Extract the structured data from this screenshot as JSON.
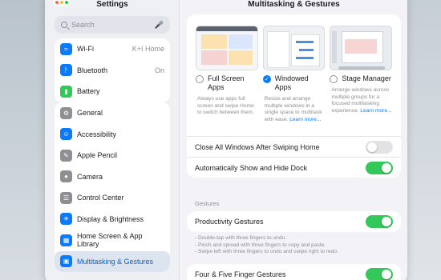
{
  "sidebar": {
    "title": "Settings",
    "search_placeholder": "Search",
    "items": [
      {
        "label": "Wi-Fi",
        "value": "K+I Home",
        "icon": "wifi-icon",
        "color": "#0a7aff"
      },
      {
        "label": "Bluetooth",
        "value": "On",
        "icon": "bluetooth-icon",
        "color": "#0a7aff"
      },
      {
        "label": "Battery",
        "value": "",
        "icon": "battery-icon",
        "color": "#34c759"
      },
      {
        "label": "General",
        "icon": "gear-icon",
        "color": "#8e8e93"
      },
      {
        "label": "Accessibility",
        "icon": "accessibility-icon",
        "color": "#0a7aff"
      },
      {
        "label": "Apple Pencil",
        "icon": "pencil-icon",
        "color": "#8e8e93"
      },
      {
        "label": "Camera",
        "icon": "camera-icon",
        "color": "#8e8e93"
      },
      {
        "label": "Control Center",
        "icon": "control-center-icon",
        "color": "#8e8e93"
      },
      {
        "label": "Display & Brightness",
        "icon": "sun-icon",
        "color": "#0a7aff"
      },
      {
        "label": "Home Screen & App Library",
        "icon": "home-screen-icon",
        "color": "#0a7aff"
      },
      {
        "label": "Multitasking & Gestures",
        "icon": "multitasking-icon",
        "color": "#0a7aff"
      }
    ]
  },
  "main": {
    "title": "Multitasking & Gestures",
    "options": [
      {
        "label": "Full Screen Apps",
        "desc": "Always use apps full screen and swipe Home to switch between them.",
        "link": ""
      },
      {
        "label": "Windowed Apps",
        "desc": "Resize and arrange multiple windows in a single space to multitask with ease.",
        "link": "Learn more..."
      },
      {
        "label": "Stage Manager",
        "desc": "Arrange windows across multiple groups for a focused multitasking experience.",
        "link": "Learn more..."
      }
    ],
    "toggles": [
      {
        "label": "Close All Windows After Swiping Home",
        "on": false
      },
      {
        "label": "Automatically Show and Hide Dock",
        "on": true
      }
    ],
    "gestures_header": "Gestures",
    "productivity": {
      "label": "Productivity Gestures",
      "on": true
    },
    "productivity_notes": [
      "- Double-tap with three fingers to undo.",
      "- Pinch and spread with three fingers to copy and paste.",
      "- Swipe left with three fingers to undo and swipe right to redo."
    ],
    "four_five": {
      "label": "Four & Five Finger Gestures",
      "on": true
    }
  }
}
